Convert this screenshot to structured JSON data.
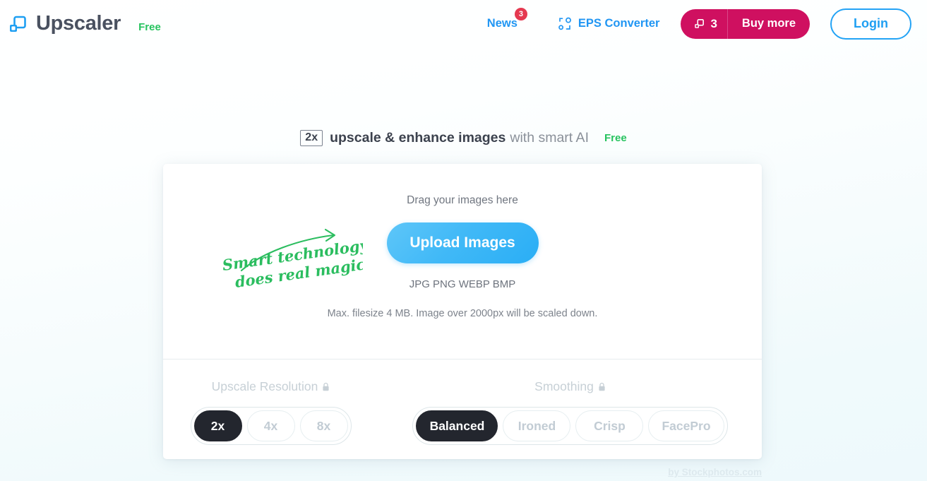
{
  "header": {
    "logo_icon": "upscaler-squares-icon",
    "brand_name": "Upscaler",
    "plan_tag": "Free",
    "nav": {
      "news_label": "News",
      "news_badge": "3",
      "eps_icon": "eps-converter-icon",
      "eps_label": "EPS Converter",
      "credits_icon": "credits-squares-icon",
      "credits_count": "3",
      "buy_more_label": "Buy more",
      "login_label": "Login"
    }
  },
  "headline": {
    "badge": "2x",
    "strong_text": "upscale & enhance images",
    "light_text": "with smart AI",
    "free_tag": "Free"
  },
  "uploader": {
    "drag_text": "Drag your images here",
    "upload_button": "Upload Images",
    "formats": "JPG PNG WEBP BMP",
    "max_size_note": "Max. filesize 4 MB. Image over 2000px will be scaled down.",
    "handwriting_line1": "Smart technology",
    "handwriting_line2": "does real magic!"
  },
  "options": {
    "resolution": {
      "label": "Upscale Resolution",
      "lock_icon": "lock-icon",
      "selected": "2x",
      "choices": [
        "2x",
        "4x",
        "8x"
      ]
    },
    "smoothing": {
      "label": "Smoothing",
      "lock_icon": "lock-icon",
      "selected": "Balanced",
      "choices": [
        "Balanced",
        "Ironed",
        "Crisp",
        "FacePro"
      ]
    }
  },
  "footer": {
    "credit": "by Stockphotos.com"
  },
  "colors": {
    "brand_blue": "#2196f3",
    "upload_blue": "#2aaef5",
    "accent_pink": "#cf1060",
    "green": "#27c35f",
    "badge_red": "#e53950",
    "dark_pill": "#23262e",
    "page_bg": "#f0fafc"
  }
}
